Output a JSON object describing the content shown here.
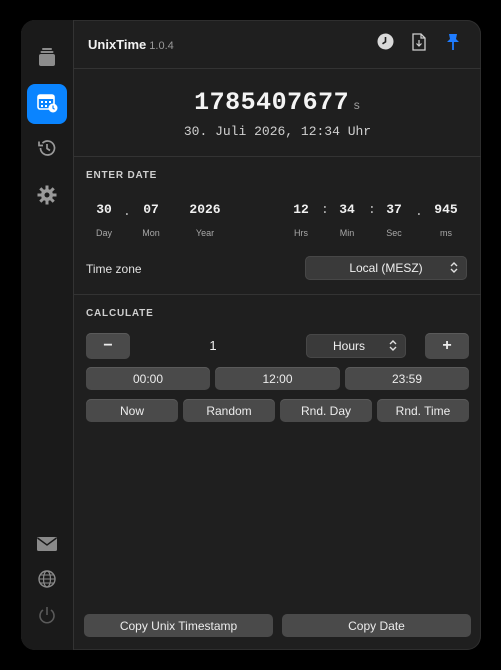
{
  "app": {
    "name": "UnixTime",
    "version": "1.0.4"
  },
  "header_icons": [
    "clock-icon",
    "document-icon",
    "pin-icon"
  ],
  "sidebar": {
    "items": [
      {
        "name": "stack-icon"
      },
      {
        "name": "calendar-icon",
        "active": true
      },
      {
        "name": "history-icon"
      },
      {
        "name": "gear-icon"
      }
    ],
    "bottom": [
      "mail-icon",
      "globe-icon",
      "power-icon"
    ]
  },
  "timestamp": {
    "value": "1785407677",
    "unit": "s",
    "date": "30. Juli 2026, 12:34 Uhr"
  },
  "enter_date": {
    "title": "ENTER DATE",
    "day": {
      "value": "30",
      "label": "Day"
    },
    "month": {
      "value": "07",
      "label": "Mon"
    },
    "year": {
      "value": "2026",
      "label": "Year"
    },
    "hours": {
      "value": "12",
      "label": "Hrs"
    },
    "minutes": {
      "value": "34",
      "label": "Min"
    },
    "seconds": {
      "value": "37",
      "label": "Sec"
    },
    "ms": {
      "value": "945",
      "label": "ms"
    },
    "sep_dot": ".",
    "sep_colon": ":",
    "timezone_label": "Time zone",
    "timezone_value": "Local (MESZ)"
  },
  "calculate": {
    "title": "CALCULATE",
    "minus": "−",
    "plus": "+",
    "amount": "1",
    "unit": "Hours",
    "times": [
      "00:00",
      "12:00",
      "23:59"
    ],
    "actions": [
      "Now",
      "Random",
      "Rnd. Day",
      "Rnd. Time"
    ]
  },
  "footer": {
    "copy_timestamp": "Copy Unix Timestamp",
    "copy_date": "Copy Date"
  },
  "colors": {
    "accent": "#0a84ff",
    "background": "#1f1f1f",
    "button": "#4a4a4a"
  }
}
